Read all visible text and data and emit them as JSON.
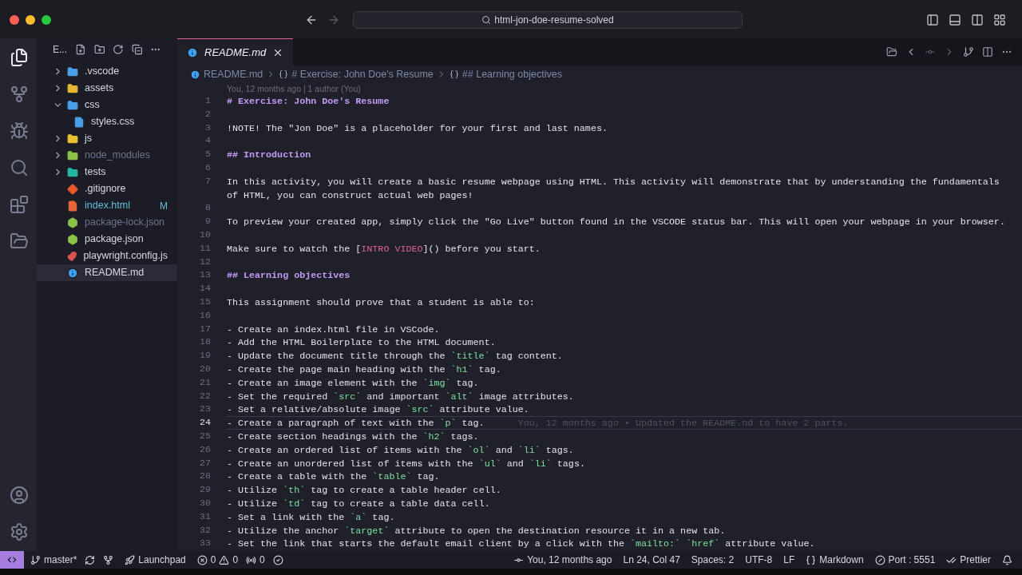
{
  "title_bar": {
    "search": "html-jon-doe-resume-solved"
  },
  "sidebar": {
    "title": "E...",
    "items": [
      {
        "name": ".vscode",
        "kind": "folder",
        "color": "#4a9fe8",
        "expanded": false,
        "dimmed": false,
        "selected": false
      },
      {
        "name": "assets",
        "kind": "folder",
        "color": "#e8b730",
        "expanded": false,
        "dimmed": false,
        "selected": false
      },
      {
        "name": "css",
        "kind": "folder",
        "color": "#4a9fe8",
        "expanded": true,
        "dimmed": false,
        "selected": false,
        "children": [
          {
            "name": "styles.css",
            "kind": "css",
            "color": "#4a9fe8",
            "dimmed": false,
            "selected": false
          }
        ]
      },
      {
        "name": "js",
        "kind": "folder",
        "color": "#e8c030",
        "expanded": false,
        "dimmed": false,
        "selected": false
      },
      {
        "name": "node_modules",
        "kind": "folder",
        "color": "#8bc34a",
        "expanded": false,
        "dimmed": true,
        "selected": false
      },
      {
        "name": "tests",
        "kind": "folder",
        "color": "#26b5a0",
        "expanded": false,
        "dimmed": false,
        "selected": false
      },
      {
        "name": ".gitignore",
        "kind": "git",
        "color": "#e8562a",
        "dimmed": false,
        "selected": false
      },
      {
        "name": "index.html",
        "kind": "html",
        "color": "#e8663a",
        "dimmed": false,
        "selected": false,
        "badge": "M"
      },
      {
        "name": "package-lock.json",
        "kind": "json",
        "color": "#8bc34a",
        "dimmed": true,
        "selected": false
      },
      {
        "name": "package.json",
        "kind": "json",
        "color": "#8bc34a",
        "dimmed": false,
        "selected": false
      },
      {
        "name": "playwright.config.js",
        "kind": "mask",
        "color": "#d9534f",
        "dimmed": false,
        "selected": false
      },
      {
        "name": "README.md",
        "kind": "info",
        "color": "#3fa2f0",
        "dimmed": false,
        "selected": true
      }
    ]
  },
  "tab": {
    "label": "README.md"
  },
  "breadcrumbs": [
    "README.md",
    "# Exercise: John Doe's Resume",
    "## Learning objectives"
  ],
  "blame_header": "You, 12 months ago | 1 author (You)",
  "lines": [
    {
      "number": "1",
      "active": false,
      "rows": [
        [
          {
            "kind": "heading",
            "text": "# Exercise: John Doe's Resume"
          }
        ]
      ]
    },
    {
      "number": "2",
      "active": false
    },
    {
      "number": "3",
      "active": false,
      "rows": [
        [
          {
            "kind": "text",
            "text": "!NOTE! The \"Jon Doe\" is a placeholder for your first and last names."
          }
        ]
      ]
    },
    {
      "number": "4",
      "active": false
    },
    {
      "number": "5",
      "active": false,
      "rows": [
        [
          {
            "kind": "heading",
            "text": "## Introduction"
          }
        ]
      ]
    },
    {
      "number": "6",
      "active": false
    },
    {
      "number": "7",
      "active": false,
      "rows": [
        [
          {
            "kind": "text",
            "text": "In this activity, you will create a basic resume webpage using HTML. This activity will demonstrate that by understanding the fundamentals"
          }
        ],
        [
          {
            "kind": "text",
            "text": "of HTML, you can construct actual web pages!"
          }
        ]
      ]
    },
    {
      "number": "8",
      "active": false
    },
    {
      "number": "9",
      "active": false,
      "rows": [
        [
          {
            "kind": "text",
            "text": "To preview your created app, simply click the \"Go Live\" button found in the VSCODE status bar. This will open your webpage in your browser."
          }
        ]
      ]
    },
    {
      "number": "10",
      "active": false
    },
    {
      "number": "11",
      "active": false,
      "rows": [
        [
          {
            "kind": "text",
            "text": "Make sure to watch the ["
          },
          {
            "kind": "link",
            "text": "INTRO VIDEO"
          },
          {
            "kind": "text",
            "text": "]() before you start."
          }
        ]
      ]
    },
    {
      "number": "12",
      "active": false
    },
    {
      "number": "13",
      "active": false,
      "rows": [
        [
          {
            "kind": "heading",
            "text": "## Learning objectives"
          }
        ]
      ]
    },
    {
      "number": "14",
      "active": false
    },
    {
      "number": "15",
      "active": false,
      "rows": [
        [
          {
            "kind": "text",
            "text": "This assignment should prove that a student is able to:"
          }
        ]
      ]
    },
    {
      "number": "16",
      "active": false
    },
    {
      "number": "17",
      "active": false,
      "rows": [
        [
          {
            "kind": "text",
            "text": "- Create an index.html file in VSCode."
          }
        ]
      ]
    },
    {
      "number": "18",
      "active": false,
      "rows": [
        [
          {
            "kind": "text",
            "text": "- Add the HTML Boilerplate to the HTML document."
          }
        ]
      ]
    },
    {
      "number": "19",
      "active": false,
      "rows": [
        [
          {
            "kind": "text",
            "text": "- Update the document title through the "
          },
          {
            "kind": "code",
            "text": "`title`"
          },
          {
            "kind": "text",
            "text": " tag content."
          }
        ]
      ]
    },
    {
      "number": "20",
      "active": false,
      "rows": [
        [
          {
            "kind": "text",
            "text": "- Create the page main heading with the "
          },
          {
            "kind": "code",
            "text": "`h1`"
          },
          {
            "kind": "text",
            "text": " tag."
          }
        ]
      ]
    },
    {
      "number": "21",
      "active": false,
      "rows": [
        [
          {
            "kind": "text",
            "text": "- Create an image element with the "
          },
          {
            "kind": "code",
            "text": "`img`"
          },
          {
            "kind": "text",
            "text": " tag."
          }
        ]
      ]
    },
    {
      "number": "22",
      "active": false,
      "rows": [
        [
          {
            "kind": "text",
            "text": "- Set the required "
          },
          {
            "kind": "code",
            "text": "`src`"
          },
          {
            "kind": "text",
            "text": " and important "
          },
          {
            "kind": "code",
            "text": "`alt`"
          },
          {
            "kind": "text",
            "text": " image attributes."
          }
        ]
      ]
    },
    {
      "number": "23",
      "active": false,
      "rows": [
        [
          {
            "kind": "text",
            "text": "- Set a relative/absolute image "
          },
          {
            "kind": "code",
            "text": "`src`"
          },
          {
            "kind": "text",
            "text": " attribute value."
          }
        ]
      ]
    },
    {
      "number": "24",
      "active": true,
      "blame": "You, 12 months ago • Updated the README.nd to have 2 parts.",
      "rows": [
        [
          {
            "kind": "text",
            "text": "- Create a paragraph of text with the "
          },
          {
            "kind": "code",
            "text": "`p`"
          },
          {
            "kind": "text",
            "text": " tag."
          }
        ]
      ]
    },
    {
      "number": "25",
      "active": false,
      "rows": [
        [
          {
            "kind": "text",
            "text": "- Create section headings with the "
          },
          {
            "kind": "code",
            "text": "`h2`"
          },
          {
            "kind": "text",
            "text": " tags."
          }
        ]
      ]
    },
    {
      "number": "26",
      "active": false,
      "rows": [
        [
          {
            "kind": "text",
            "text": "- Create an ordered list of items with the "
          },
          {
            "kind": "code",
            "text": "`ol`"
          },
          {
            "kind": "text",
            "text": " and "
          },
          {
            "kind": "code",
            "text": "`li`"
          },
          {
            "kind": "text",
            "text": " tags."
          }
        ]
      ]
    },
    {
      "number": "27",
      "active": false,
      "rows": [
        [
          {
            "kind": "text",
            "text": "- Create an unordered list of items with the "
          },
          {
            "kind": "code",
            "text": "`ul`"
          },
          {
            "kind": "text",
            "text": " and "
          },
          {
            "kind": "code",
            "text": "`li`"
          },
          {
            "kind": "text",
            "text": " tags."
          }
        ]
      ]
    },
    {
      "number": "28",
      "active": false,
      "rows": [
        [
          {
            "kind": "text",
            "text": "- Create a table with the "
          },
          {
            "kind": "code",
            "text": "`table`"
          },
          {
            "kind": "text",
            "text": " tag."
          }
        ]
      ]
    },
    {
      "number": "29",
      "active": false,
      "rows": [
        [
          {
            "kind": "text",
            "text": "- Utilize "
          },
          {
            "kind": "code",
            "text": "`th`"
          },
          {
            "kind": "text",
            "text": " tag to create a table header cell."
          }
        ]
      ]
    },
    {
      "number": "30",
      "active": false,
      "rows": [
        [
          {
            "kind": "text",
            "text": "- Utilize "
          },
          {
            "kind": "code",
            "text": "`td`"
          },
          {
            "kind": "text",
            "text": " tag to create a table data cell."
          }
        ]
      ]
    },
    {
      "number": "31",
      "active": false,
      "rows": [
        [
          {
            "kind": "text",
            "text": "- Set a link with the "
          },
          {
            "kind": "code",
            "text": "`a`"
          },
          {
            "kind": "text",
            "text": " tag."
          }
        ]
      ]
    },
    {
      "number": "32",
      "active": false,
      "rows": [
        [
          {
            "kind": "text",
            "text": "- Utilize the anchor "
          },
          {
            "kind": "code",
            "text": "`target`"
          },
          {
            "kind": "text",
            "text": " attribute to open the destination resource it in a new tab."
          }
        ]
      ]
    },
    {
      "number": "33",
      "active": false,
      "rows": [
        [
          {
            "kind": "text",
            "text": "- Set the link that starts the default email client by a click with the "
          },
          {
            "kind": "code",
            "text": "`mailto:`"
          },
          {
            "kind": "text",
            "text": " "
          },
          {
            "kind": "code",
            "text": "`href`"
          },
          {
            "kind": "text",
            "text": " attribute value."
          }
        ]
      ]
    }
  ],
  "status_bar": {
    "branch": "master*",
    "launchpad": "Launchpad",
    "errors": "0",
    "warnings": "0",
    "ports": "0",
    "blame": "You, 12 months ago",
    "position": "Ln 24, Col 47",
    "spaces": "Spaces: 2",
    "encoding": "UTF-8",
    "eol": "LF",
    "language": "Markdown",
    "port": "Port : 5551",
    "formatter": "Prettier"
  }
}
